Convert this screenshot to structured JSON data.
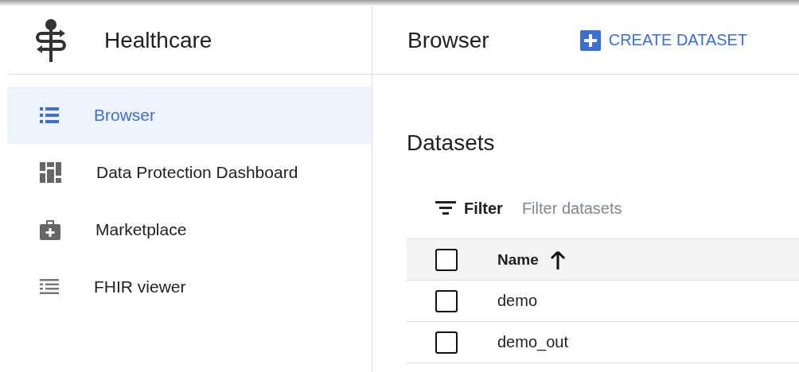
{
  "sidebar": {
    "title": "Healthcare",
    "items": [
      {
        "label": "Browser",
        "selected": true
      },
      {
        "label": "Data Protection Dashboard",
        "selected": false
      },
      {
        "label": "Marketplace",
        "selected": false
      },
      {
        "label": "FHIR viewer",
        "selected": false
      }
    ]
  },
  "header": {
    "title": "Browser",
    "action": "CREATE DATASET"
  },
  "section": {
    "title": "Datasets"
  },
  "filter": {
    "label": "Filter",
    "placeholder": "Filter datasets"
  },
  "table": {
    "columns": [
      {
        "label": "Name",
        "checked": false
      }
    ],
    "rows": [
      {
        "name": "demo",
        "checked": false
      },
      {
        "name": "demo_out",
        "checked": false
      }
    ]
  }
}
